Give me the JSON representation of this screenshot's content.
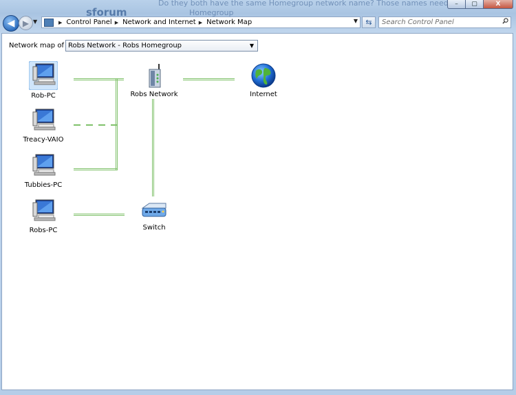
{
  "background": {
    "text_line1": "Do they both have the same Homegroup network name? Those names need to match",
    "text_line2": "Homegroup",
    "logo_fragment": "sforum"
  },
  "caption_buttons": {
    "minimize": "–",
    "maximize": "▢",
    "close": "X"
  },
  "nav": {
    "back_symbol": "◀",
    "forward_symbol": "▶",
    "breadcrumb": [
      "Control Panel",
      "Network and Internet",
      "Network Map"
    ],
    "search_placeholder": "Search Control Panel"
  },
  "network_map": {
    "label": "Network map of",
    "selected_network": "Robs Network - Robs Homegroup",
    "devices": [
      {
        "name": "Rob-PC",
        "icon": "computer-icon",
        "selected": true
      },
      {
        "name": "Treacy-VAIO",
        "icon": "computer-icon",
        "selected": false
      },
      {
        "name": "Tubbies-PC",
        "icon": "computer-icon",
        "selected": false
      },
      {
        "name": "Robs-PC",
        "icon": "computer-icon",
        "selected": false
      }
    ],
    "infrastructure": [
      {
        "name": "Robs Network",
        "icon": "wireless-router-icon"
      },
      {
        "name": "Internet",
        "icon": "globe-icon"
      },
      {
        "name": "Switch",
        "icon": "network-switch-icon"
      }
    ],
    "connection_color": "#7fc16a"
  }
}
